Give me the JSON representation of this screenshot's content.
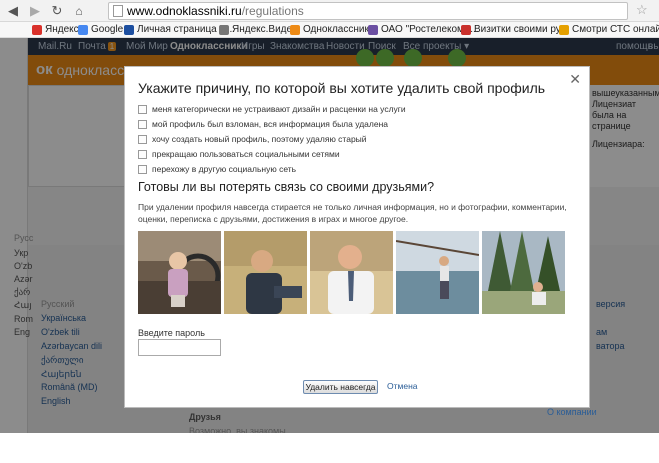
{
  "browser": {
    "url_host": "www.odnoklassniki.ru",
    "url_path": "/regulations",
    "back_icon": "arrow-left-icon",
    "forward_icon": "arrow-right-icon",
    "reload_icon": "reload-icon",
    "bookmarks": [
      {
        "label": "Яндекс",
        "icon_color": "#d9312b"
      },
      {
        "label": "Google",
        "icon_color": "#4688f1"
      },
      {
        "label": "Личная страница Н...",
        "icon_color": "#1d4fa0"
      },
      {
        "label": "Яндекс.Видео",
        "icon_color": "#777777"
      },
      {
        "label": "Одноклассники",
        "icon_color": "#ed8a15"
      },
      {
        "label": "ОАО \"Ростелеком\" ...",
        "icon_color": "#6b4fa2"
      },
      {
        "label": "Визитки своими ру...",
        "icon_color": "#c9302c"
      },
      {
        "label": "Смотри СТС онлайн...",
        "icon_color": "#e5a000"
      }
    ]
  },
  "mailbar": {
    "items": [
      "Mail.Ru",
      "Почта",
      "Мой Мир",
      "Одноклассники",
      "Игры",
      "Знакомства",
      "Новости",
      "Поиск",
      "Все проекты ▾"
    ],
    "mail_badge": "1",
    "right": [
      "помощь",
      "вы"
    ]
  },
  "okbar": {
    "logo_text": "одноклассники"
  },
  "page_bg_text": {
    "right_lines": [
      "вышеуказанным",
      "Лицензиат",
      "была на странице",
      "Лицензиара:"
    ]
  },
  "footer": {
    "left_col": [
      "Русский",
      "Українська",
      "O'zbek tili",
      "Azərbaycan dili",
      "ქართული",
      "Հայերեն",
      "Română (MD)",
      "English"
    ],
    "left_cut": [
      "Русс",
      "Укр",
      "O'zb",
      "Azər",
      "ქარ",
      "Հայ",
      "Rom",
      "Eng"
    ],
    "center": [
      "Друзья",
      "Возможно, вы знакомы"
    ],
    "right": [
      "версия",
      "ам",
      "ватора",
      "О компании"
    ]
  },
  "modal": {
    "title": "Укажите причину, по которой вы хотите удалить свой профиль",
    "close_icon": "close-icon",
    "reasons": [
      "меня категорически не устраивают дизайн и расценки на услуги",
      "мой профиль был взломан, вся информация была удалена",
      "хочу создать новый профиль, поэтому удаляю старый",
      "прекращаю пользоваться социальными сетями",
      "перехожу в другую социальную сеть"
    ],
    "friends_title": "Готовы ли вы потерять связь со своими друзьями?",
    "friends_desc": "При удалении профиля навсегда стирается не только личная информация, но и фотографии, комментарии, оценки, переписка с друзьями, достижения в играх и многое другое.",
    "password_label": "Введите пароль",
    "password_value": "",
    "delete_button": "Удалить навсегда",
    "cancel_link": "Отмена"
  }
}
